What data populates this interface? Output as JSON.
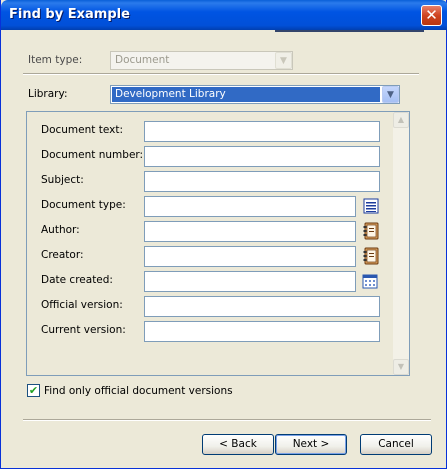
{
  "window": {
    "title": "Find by Example",
    "close_glyph": "✕"
  },
  "item_type": {
    "label": "Item type:",
    "value": "Document",
    "disabled": true
  },
  "library": {
    "label": "Library:",
    "value": "Development Library"
  },
  "fields": [
    {
      "label": "Document text:",
      "value": ""
    },
    {
      "label": "Document number:",
      "value": ""
    },
    {
      "label": "Subject:",
      "value": ""
    },
    {
      "label": "Document type:",
      "value": "",
      "picker_icon": "list-picker-icon"
    },
    {
      "label": "Author:",
      "value": "",
      "picker_icon": "address-book-icon"
    },
    {
      "label": "Creator:",
      "value": "",
      "picker_icon": "address-book-icon"
    },
    {
      "label": "Date created:",
      "value": "",
      "picker_icon": "calendar-icon"
    },
    {
      "label": "Official version:",
      "value": ""
    },
    {
      "label": "Current version:",
      "value": ""
    }
  ],
  "find_official": {
    "label": "Find only official document versions",
    "checked": true,
    "check_glyph": "✔"
  },
  "buttons": {
    "back": "< Back",
    "next": "Next >",
    "cancel": "Cancel"
  },
  "colors": {
    "title_bar": "#0054e3",
    "selection": "#316ac5",
    "face": "#ece9d8"
  }
}
